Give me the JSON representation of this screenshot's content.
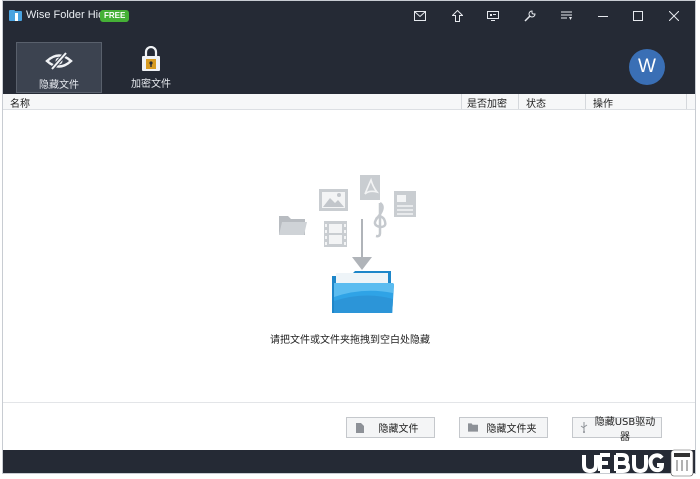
{
  "window": {
    "title": "Wise Folder Hider",
    "badge": "FREE"
  },
  "titlebar_buttons": [
    {
      "name": "mail-icon"
    },
    {
      "name": "upgrade-arrow-icon"
    },
    {
      "name": "screen-icon"
    },
    {
      "name": "tools-icon"
    },
    {
      "name": "menu-icon"
    },
    {
      "name": "minimize-icon"
    },
    {
      "name": "maximize-icon"
    },
    {
      "name": "close-icon"
    }
  ],
  "tabs": [
    {
      "label": "隐藏文件",
      "icon": "eye-hidden-icon",
      "active": true
    },
    {
      "label": "加密文件",
      "icon": "lock-file-icon",
      "active": false
    }
  ],
  "user": {
    "avatar_letter": "W"
  },
  "table": {
    "columns": [
      "名称",
      "是否加密",
      "状态",
      "操作"
    ]
  },
  "empty_hint": "请把文件或文件夹拖拽到空白处隐藏",
  "footer_buttons": [
    {
      "label": "隐藏文件",
      "icon": "file-icon"
    },
    {
      "label": "隐藏文件夹",
      "icon": "folder-icon"
    },
    {
      "label": "隐藏USB驱动器",
      "icon": "usb-icon"
    }
  ],
  "colors": {
    "titlebar_bg": "#252a35",
    "active_tab_bg": "#3c4350",
    "badge_green": "#45b036",
    "avatar_blue": "#3a6fb5",
    "folder_blue": "#2fa3e6"
  }
}
